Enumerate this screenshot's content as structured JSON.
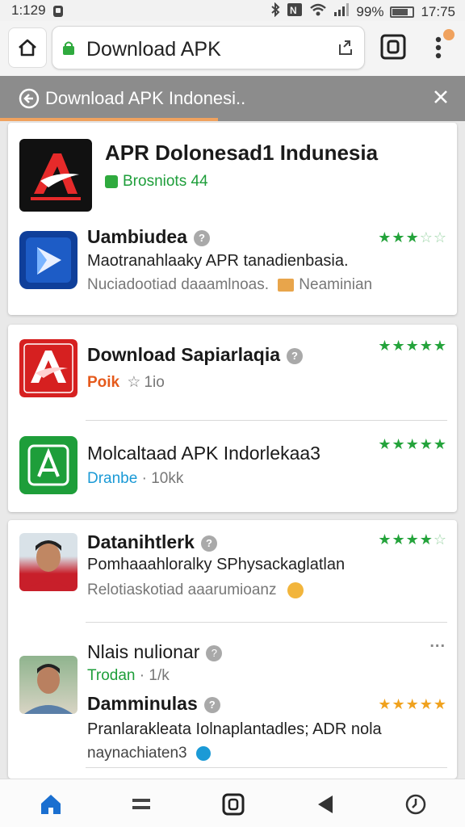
{
  "status_bar": {
    "time_left": "1:129",
    "battery": "99%",
    "time_right": "17:75"
  },
  "browser": {
    "url_text": "Download APK",
    "tab_title": "Download APK  Indonesi..",
    "accent_color": "#f0a25e"
  },
  "cards": [
    {
      "apps": [
        {
          "name": "APR Dolonesad1 Indunesia",
          "sub": "Brosniots 44",
          "icon": "apk-red-logo-icon"
        },
        {
          "name": "Uambiudea",
          "desc": "Maotranahlaaky APR tanadienbasia.",
          "sub": "Nuciadootiad daaamlnoas.",
          "sub_extra": "Neaminian",
          "stars": 3
        }
      ]
    },
    {
      "apps": [
        {
          "name": "Download Sapiarlaqia",
          "sub_accent": "Poik",
          "sub": "1io",
          "stars": 5
        },
        {
          "name": "Molcaltaad APK Indorlekaa3",
          "sub_accent": "Dranbe",
          "sub": "10kk",
          "stars": 5
        }
      ]
    },
    {
      "apps": [
        {
          "name": "Datanihtlerk",
          "desc": "Pomhaaahloralky SPhysackaglatlan",
          "sub": "Relotiaskotiad aaarumioanz",
          "stars": 4
        },
        {
          "name": "Nlais nulionar",
          "sub_accent": "Trodan",
          "sub": "1/k",
          "more": "..."
        },
        {
          "name": "Damminulas",
          "desc": "Pranlarakleata Iolnaplantadles; ADR nola",
          "sub": "naynachiaten3",
          "stars": 5
        }
      ]
    }
  ],
  "colors": {
    "star_green": "#24a33b",
    "star_orange": "#f0a21e",
    "green_text": "#1e9e3a",
    "blue_text": "#1b9ad6",
    "orange_text": "#e55a1c"
  }
}
